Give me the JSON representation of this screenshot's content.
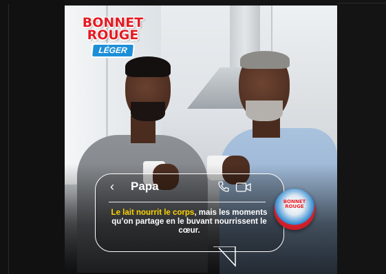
{
  "post": {
    "logo": {
      "brand_line1": "BONNET",
      "brand_line2": "ROUGE",
      "variant": "LÉGER",
      "brand_color": "#e31b23",
      "variant_color": "#1d8fd8"
    },
    "chat": {
      "back_icon": "chevron-left-icon",
      "contact_name": "Papa",
      "call_icon": "phone-icon",
      "video_icon": "video-camera-icon",
      "message_highlight": "Le lait nourrit le corps",
      "message_rest": ", mais les moments qu’on partage en le buvant nourrissent le cœur.",
      "highlight_color": "#ffd200"
    },
    "product": {
      "icon": "milk-can-icon",
      "label_line1": "BONNET",
      "label_line2": "ROUGE"
    }
  }
}
